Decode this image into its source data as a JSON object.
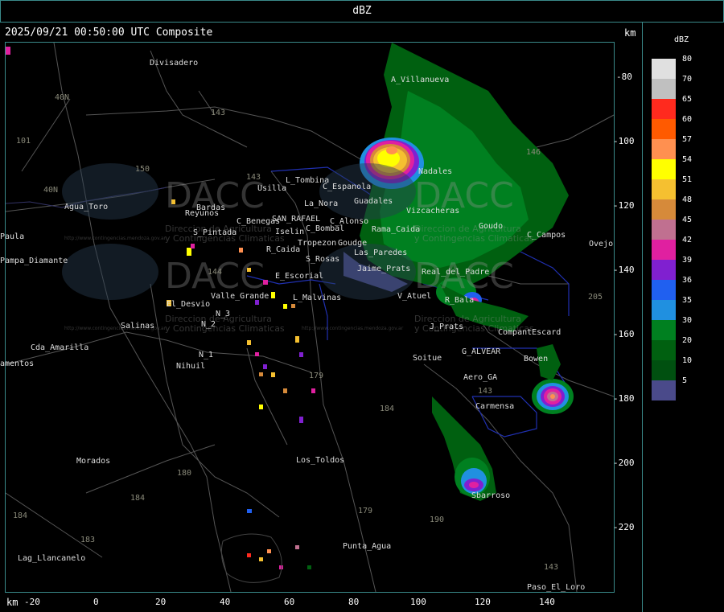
{
  "header": {
    "title": "dBZ"
  },
  "map": {
    "timestamp": "2025/09/21 00:50:00 UTC Composite",
    "km_label_top": "km",
    "km_label_bottom": "km",
    "y_ticks": [
      "-80",
      "-100",
      "-120",
      "-140",
      "-160",
      "-180",
      "-200",
      "-220"
    ],
    "x_ticks": [
      "-20",
      "0",
      "20",
      "40",
      "60",
      "80",
      "100",
      "120",
      "140"
    ],
    "places": [
      "Divisadero",
      "A_Villanueva",
      "Usilla",
      "L_Tombina",
      "C_Espanola",
      "Reyunos",
      "S_Pintada",
      "C_Benegas",
      "SAN_RAFAEL",
      "La_Nora",
      "C_Alonso",
      "C_Bombal",
      "Iselin",
      "Tropezon",
      "Goudge",
      "R_Caida",
      "S_Rosas",
      "Agua_Toro",
      "Paula",
      "Pampa_Diamante",
      "El_Desvio",
      "Valle_Grande",
      "E_Escorial",
      "L_Malvinas",
      "V_Atuel",
      "R_Bala",
      "J_Prats",
      "CompantEscard",
      "Salinas",
      "N_2",
      "N_1",
      "N_3",
      "Cda_Amarilla",
      "amentos",
      "Nihuil",
      "G_ALVEAR",
      "Soitue",
      "Bowen",
      "Aero_GA",
      "Carmensa",
      "Morados",
      "Los_Toldos",
      "Lag_Llancanelo",
      "Punta_Agua",
      "Paso_El_Loro",
      "Ovejo",
      "C_Campos",
      "Goudo",
      "Rama_Caida",
      "Jaime_Prats",
      "Real_del_Padre",
      "Nadales",
      "Vizcacheras",
      "Guadales",
      "Sbarroso",
      "Las_Paredes",
      "Bardas"
    ],
    "roads": [
      "101",
      "40N",
      "40N",
      "143",
      "150",
      "143",
      "144",
      "179",
      "184",
      "180",
      "184",
      "183",
      "184",
      "179",
      "190",
      "146",
      "205",
      "143",
      "143"
    ],
    "watermark": {
      "brand": "DACC",
      "line1": "Direccion de Agricultura",
      "line2": "y Contingencias Climaticas",
      "url": "http://www.contingencias.mendoza.gov.ar"
    }
  },
  "legend": {
    "unit": "dBZ",
    "levels": [
      {
        "label": "80",
        "color": "#e0e0e0"
      },
      {
        "label": "70",
        "color": "#c0c0c0"
      },
      {
        "label": "65",
        "color": "#ff2a1e"
      },
      {
        "label": "60",
        "color": "#ff5a00"
      },
      {
        "label": "57",
        "color": "#ff9050"
      },
      {
        "label": "54",
        "color": "#ffff00"
      },
      {
        "label": "51",
        "color": "#f5c030"
      },
      {
        "label": "48",
        "color": "#d68a3a"
      },
      {
        "label": "45",
        "color": "#c07090"
      },
      {
        "label": "42",
        "color": "#e020a0"
      },
      {
        "label": "39",
        "color": "#8020d0"
      },
      {
        "label": "36",
        "color": "#2060f0"
      },
      {
        "label": "35",
        "color": "#2090e0"
      },
      {
        "label": "30",
        "color": "#008020"
      },
      {
        "label": "20",
        "color": "#006010"
      },
      {
        "label": "10",
        "color": "#005010"
      },
      {
        "label": "5",
        "color": "#4a4a8a"
      }
    ]
  }
}
